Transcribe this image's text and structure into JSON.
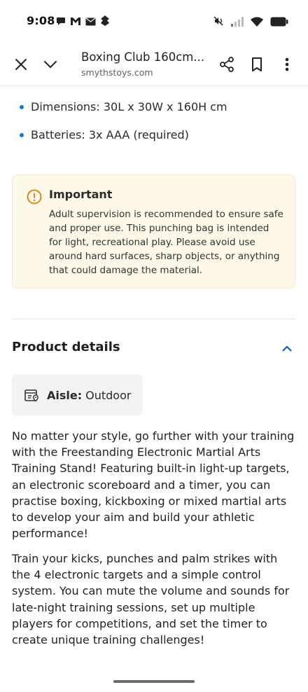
{
  "status_bar": {
    "time": "9:08",
    "notification_icons": [
      "chat-bubble-icon",
      "gmail-icon",
      "mail-icon",
      "app-icon"
    ],
    "system_icons": [
      "mute-icon",
      "signal-icon",
      "wifi-icon",
      "battery-icon"
    ]
  },
  "toolbar": {
    "title": "Boxing Club 160cm...",
    "url": "smythstoys.com",
    "icons": [
      "close-icon",
      "chevron-down-icon",
      "share-icon",
      "bookmark-icon",
      "more-vert-icon"
    ]
  },
  "specs": [
    "Dimensions: 30L x 30W x 160H cm",
    "Batteries: 3x AAA (required)"
  ],
  "important": {
    "title": "Important",
    "text": "Adult supervision is recommended to ensure safe and proper use. This punching bag is intended for light, recreational play. Please avoid use around hard surfaces, sharp objects, or anything that could damage the material.",
    "accent_color": "#d98a1e",
    "background_color": "#fdf8e7"
  },
  "product_details": {
    "title": "Product details",
    "expanded": true,
    "aisle": {
      "label": "Aisle:",
      "value": "Outdoor"
    },
    "paragraphs": [
      "No matter your style, go further with your training with the Freestanding Electronic Martial Arts Training Stand! Featuring built-in light-up targets, an electronic scoreboard and a timer, you can practise boxing, kickboxing or mixed martial arts to develop your aim and build your athletic performance!",
      "Train your kicks, punches and palm strikes with the 4 electronic targets and a simple control system. You can mute the volume and sounds for late-night training sessions, set up multiple players for competitions, and set the timer to create unique training challenges!"
    ]
  },
  "colors": {
    "bullet": "#1a75c7",
    "chevron": "#1a5fa8"
  }
}
